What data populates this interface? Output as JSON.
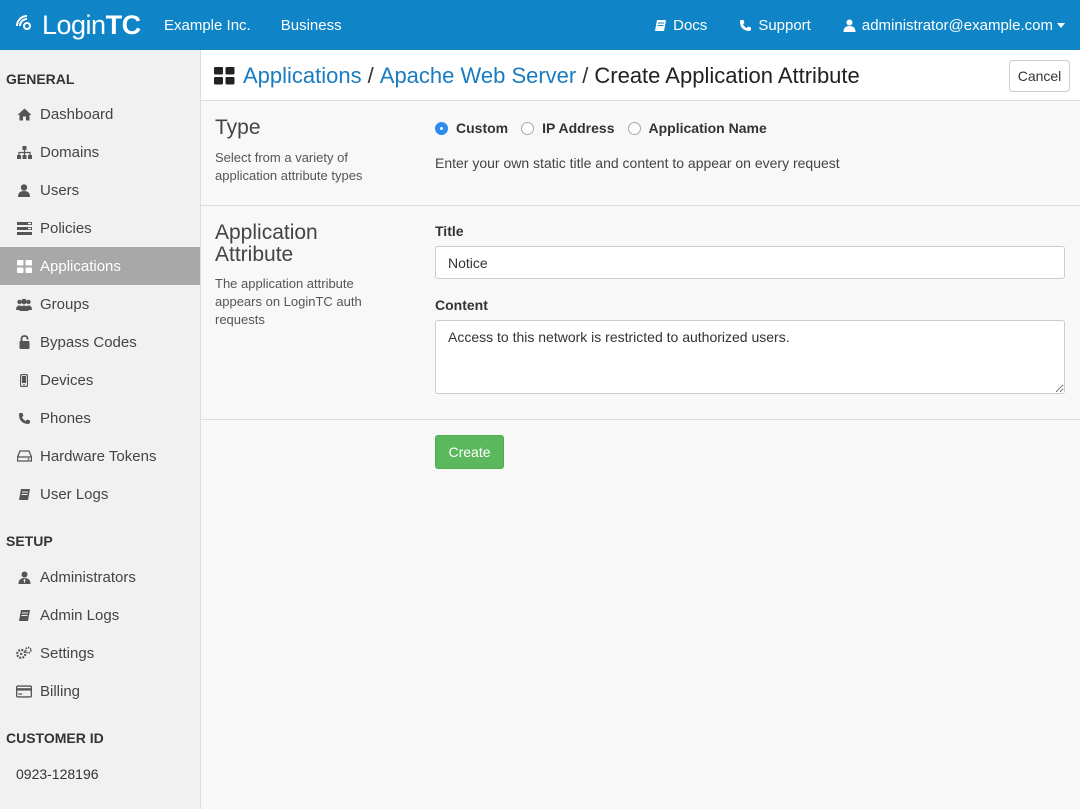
{
  "header": {
    "brand_light": "Login",
    "brand_bold": "TC",
    "org_name": "Example Inc.",
    "plan": "Business",
    "docs_label": "Docs",
    "support_label": "Support",
    "user_email": "administrator@example.com",
    "accent_color": "#0f85c7"
  },
  "sidebar": {
    "general_heading": "GENERAL",
    "general_items": [
      {
        "label": "Dashboard",
        "icon": "home-icon"
      },
      {
        "label": "Domains",
        "icon": "sitemap-icon"
      },
      {
        "label": "Users",
        "icon": "user-icon"
      },
      {
        "label": "Policies",
        "icon": "list-icon"
      },
      {
        "label": "Applications",
        "icon": "grid-icon",
        "active": true
      },
      {
        "label": "Groups",
        "icon": "group-icon"
      },
      {
        "label": "Bypass Codes",
        "icon": "unlock-icon"
      },
      {
        "label": "Devices",
        "icon": "mobile-icon"
      },
      {
        "label": "Phones",
        "icon": "phone-icon"
      },
      {
        "label": "Hardware Tokens",
        "icon": "hdd-icon"
      },
      {
        "label": "User Logs",
        "icon": "book-icon"
      }
    ],
    "setup_heading": "SETUP",
    "setup_items": [
      {
        "label": "Administrators",
        "icon": "admin-icon"
      },
      {
        "label": "Admin Logs",
        "icon": "book-icon"
      },
      {
        "label": "Settings",
        "icon": "gears-icon"
      },
      {
        "label": "Billing",
        "icon": "credit-card-icon"
      }
    ],
    "customer_heading": "CUSTOMER ID",
    "customer_id": "0923-128196"
  },
  "breadcrumb": {
    "crumb1": "Applications",
    "sep": "/",
    "crumb2": "Apache Web Server",
    "current": "Create Application Attribute"
  },
  "cancel_label": "Cancel",
  "type_section": {
    "title": "Type",
    "description": "Select from a variety of application attribute types",
    "options": [
      {
        "label": "Custom",
        "selected": true
      },
      {
        "label": "IP Address",
        "selected": false
      },
      {
        "label": "Application Name",
        "selected": false
      }
    ],
    "help": "Enter your own static title and content to appear on every request"
  },
  "attribute_section": {
    "title_line1": "Application",
    "title_line2": "Attribute",
    "description": "The application attribute appears on LoginTC auth requests",
    "title_label": "Title",
    "title_value": "Notice",
    "content_label": "Content",
    "content_value": "Access to this network is restricted to authorized users."
  },
  "create_label": "Create"
}
